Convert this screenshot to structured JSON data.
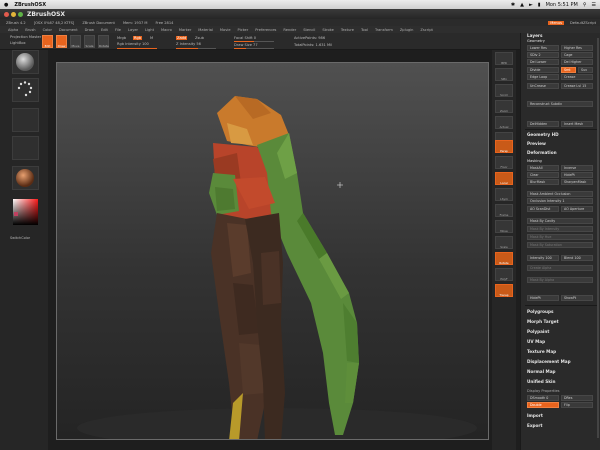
{
  "macos": {
    "apple": "",
    "app_name": "ZBrushOSX",
    "time": "Mon 5:51 PM",
    "right_icons": [
      "bluetooth-icon",
      "wifi-icon",
      "volume-icon",
      "battery-icon",
      "search-icon",
      "list-icon"
    ]
  },
  "window": {
    "title": "ZBrushOSX"
  },
  "zstrip": {
    "items": [
      "ZBrush 4.2",
      "[OSX 0%67 48,2 KTFS]",
      "ZBrush Document",
      "Mem: 1937 M",
      "Free 2814"
    ],
    "right": [
      "Menus",
      "DefaultZScript"
    ]
  },
  "menubar": {
    "items": [
      "Alpha",
      "Brush",
      "Color",
      "Document",
      "Draw",
      "Edit",
      "File",
      "Layer",
      "Light",
      "Macro",
      "Marker",
      "Material",
      "Movie",
      "Picker",
      "Preferences",
      "Render",
      "Stencil",
      "Stroke",
      "Texture",
      "Tool",
      "Transform",
      "Zplugin",
      "Zscript"
    ]
  },
  "toolbar": {
    "projection_master": "Projection Master",
    "lightbox": "LightBox",
    "edit": "Edit",
    "draw": "Draw",
    "move": "Move",
    "scale": "Scale",
    "rotate": "Rotate",
    "mrgb": "Mrgb",
    "rgb": "Rgb",
    "m": "M",
    "zadd": "Zadd",
    "zsub": "Zsub",
    "rgb_intensity": "Rgb Intensity 100",
    "z_intensity": "Z Intensity 56",
    "focal_shift": "Focal Shift 0",
    "draw_size": "Draw Size 77",
    "active_points": "ActivePoints: 986",
    "total_points": "TotalPoints: 1.631 Mil"
  },
  "left_shelf": {
    "brush_label": "Standard",
    "stroke_label": "Dots",
    "alpha_label": "Alpha Off",
    "texture_label": "Texture Off",
    "material_label": "SkinShade4",
    "color_label": "SwitchColor"
  },
  "vbar": {
    "buttons": [
      "BPR",
      "SPix",
      "Scroll",
      "Zoom",
      "Actual",
      "AAHalf",
      "Persp",
      "Floor",
      "Local",
      "LSym",
      "Frame",
      "Move",
      "Scale",
      "Rotate",
      "PolyF",
      "Transp",
      "Ghost",
      "Solo",
      "Xpose"
    ]
  },
  "rpanel": {
    "layers": "Layers",
    "geometry": "Geometry",
    "lower_res": "Lower Res",
    "higher_res": "Higher Res",
    "sdiv": "SDiv 2",
    "cage": "Cage",
    "del_lower": "Del Lower",
    "del_higher": "Del Higher",
    "divide": "Divide",
    "smt": "Smt",
    "suv": "Suv",
    "edge_loop": "Edge Loop",
    "crease": "Crease",
    "uncrease": "UnCrease",
    "crease_lvl": "Crease Lvl 15",
    "reconstruct": "Reconstruct Subdiv",
    "convert": "Convert BPR To Geo",
    "delhidden": "DelHidden",
    "insert_mesh": "Insert Mesh",
    "geometry_hd": "Geometry HD",
    "preview": "Preview",
    "deformation": "Deformation",
    "masking": "Masking",
    "mask_all": "MaskAll",
    "inverse": "Inverse",
    "clear": "Clear",
    "hide_pt": "HidePt",
    "blur_mask": "BlurMask",
    "sharpen_mask": "SharpenMask",
    "mask_ao": "Mask Ambient Occlusion",
    "occlusion_intensity": "Occlusion Intensity 1",
    "ao_scatter": "AO ScanDist",
    "ao_aperture": "AO Aperture",
    "mask_by_cavity": "Mask By Cavity",
    "mask_by_intensity": "Mask By Intensity",
    "mask_by_hue": "Mask By Hue",
    "mask_by_saturation": "Mask By Saturation",
    "intensity": "Intensity 100",
    "blend": "Blend 100",
    "create_alpha": "Create Alpha",
    "mask_by_alpha": "Mask By Alpha",
    "visibility": "Visibility",
    "hide_pt2": "HidePt",
    "show_pt": "ShowPt",
    "polygroups": "Polygroups",
    "morph_target": "Morph Target",
    "polypaint": "Polypaint",
    "uv_map": "UV Map",
    "texture_map": "Texture Map",
    "displacement_map": "Displacement Map",
    "normal_map": "Normal Map",
    "unified_skin": "Unified Skin",
    "display_properties": "Display Properties",
    "dsmooth": "DSmooth 0",
    "dres": "DRes",
    "double": "Double",
    "flip": "Flip",
    "import": "Import",
    "export": "Export"
  },
  "colors": {
    "accent": "#e8641e",
    "model_green": "#5a8a3a",
    "model_red": "#b8442a",
    "model_orange": "#c97a2c",
    "model_dark": "#4a3226"
  }
}
